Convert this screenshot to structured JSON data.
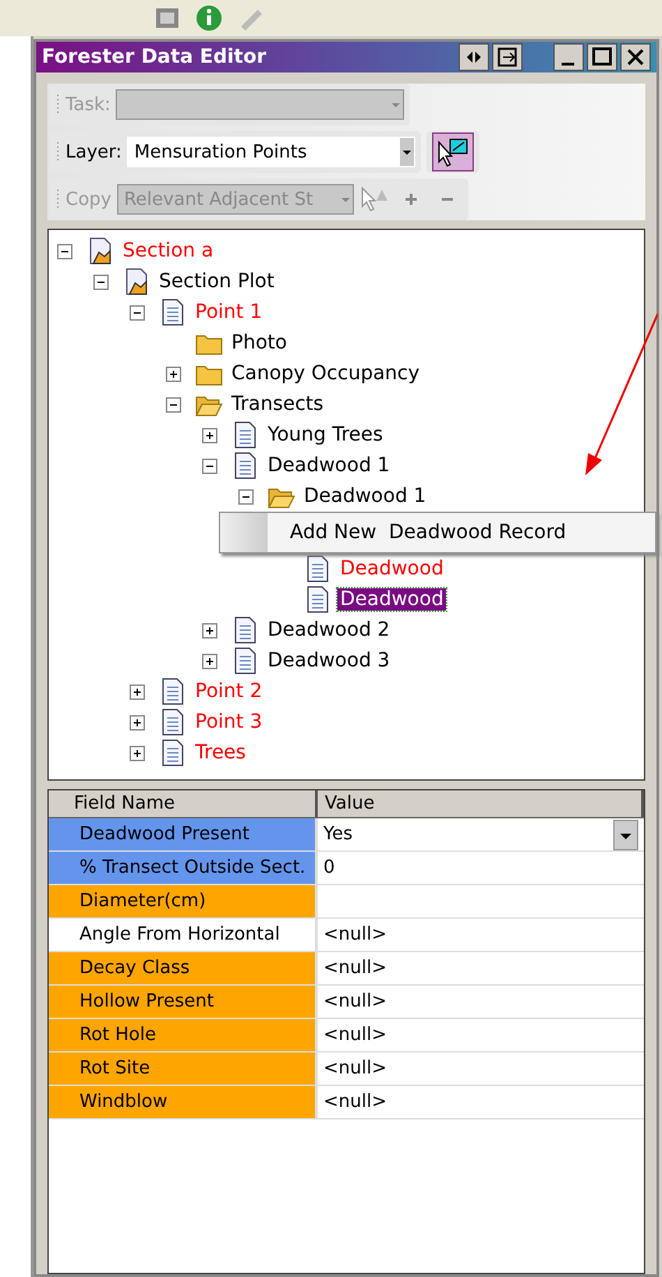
{
  "window": {
    "title": "Forester Data Editor"
  },
  "toolbar": [
    {
      "kind": "combo",
      "label": "Task:",
      "disabled": true
    },
    {
      "kind": "combo",
      "label": "Layer:",
      "value": "Mensuration Points",
      "disabled": false
    },
    {
      "kind": "copy",
      "label": "Copy",
      "value": "Relevant Adjacent St",
      "disabled": true
    }
  ],
  "tree": [
    {
      "label": "Section a",
      "kind": "section",
      "color": "#ff0000",
      "expanded": true,
      "selected": false,
      "children": [
        {
          "label": "Section Plot",
          "kind": "section",
          "color": "#000000",
          "expanded": true,
          "selected": false,
          "children": [
            {
              "label": "Point 1",
              "kind": "document",
              "color": "#ff0000",
              "expanded": true,
              "selected": false,
              "children": [
                {
                  "label": "Photo",
                  "kind": "folder",
                  "color": "#000000",
                  "selected": false
                },
                {
                  "label": "Canopy Occupancy",
                  "kind": "folder",
                  "color": "#000000",
                  "expanded": false,
                  "selected": false
                },
                {
                  "label": "Transects",
                  "kind": "folder_open",
                  "color": "#000000",
                  "expanded": true,
                  "selected": false,
                  "children": [
                    {
                      "label": "Young Trees",
                      "kind": "document",
                      "color": "#000000",
                      "expanded": false,
                      "selected": false
                    },
                    {
                      "label": "Deadwood 1",
                      "kind": "document",
                      "color": "#000000",
                      "expanded": true,
                      "selected": false,
                      "children": [
                        {
                          "label": "Deadwood 1",
                          "kind": "folder_open",
                          "color": "#000000",
                          "expanded": true,
                          "selected": false,
                          "context_menu": {
                            "items": [
                              "Add New  Deadwood Record"
                            ]
                          },
                          "children": [
                            {
                              "label": "Deadwood",
                              "kind": "document",
                              "color": "#ff0000",
                              "selected": false
                            },
                            {
                              "label": "Deadwood",
                              "kind": "document",
                              "selected": true
                            }
                          ]
                        }
                      ]
                    },
                    {
                      "label": "Deadwood 2",
                      "kind": "document",
                      "color": "#000000",
                      "expanded": false,
                      "selected": false
                    },
                    {
                      "label": "Deadwood 3",
                      "kind": "document",
                      "color": "#000000",
                      "expanded": false,
                      "selected": false
                    }
                  ]
                }
              ]
            },
            {
              "label": "Point 2",
              "kind": "document",
              "color": "#ff0000",
              "expanded": false,
              "selected": false
            },
            {
              "label": "Point 3",
              "kind": "document",
              "color": "#ff0000",
              "expanded": false,
              "selected": false
            },
            {
              "label": "Trees",
              "kind": "document",
              "color": "#ff0000",
              "expanded": false,
              "selected": false
            }
          ]
        }
      ]
    }
  ],
  "grid": {
    "columns": [
      "Field Name",
      "Value"
    ],
    "rows": [
      {
        "field": "Deadwood Present",
        "value": "Yes",
        "kind": "dropdown",
        "color": "#6495ed"
      },
      {
        "field": "% Transect Outside Sect.",
        "value": "0",
        "kind": "text",
        "color": "#6495ed"
      },
      {
        "field": "Diameter(cm)",
        "kind": "text",
        "color": "#ffa500"
      },
      {
        "field": "Angle From Horizontal",
        "value": "<null>",
        "kind": "text",
        "color": "#ffffff"
      },
      {
        "field": "Decay Class",
        "value": "<null>",
        "kind": "text",
        "color": "#ffa500"
      },
      {
        "field": "Hollow Present",
        "value": "<null>",
        "kind": "text",
        "color": "#ffa500"
      },
      {
        "field": "Rot Hole",
        "value": "<null>",
        "kind": "text",
        "color": "#ffa500"
      },
      {
        "field": "Rot Site",
        "value": "<null>",
        "kind": "text",
        "color": "#ffa500"
      },
      {
        "field": "Windblow",
        "value": "<null>",
        "kind": "text",
        "color": "#ffa500"
      }
    ]
  }
}
